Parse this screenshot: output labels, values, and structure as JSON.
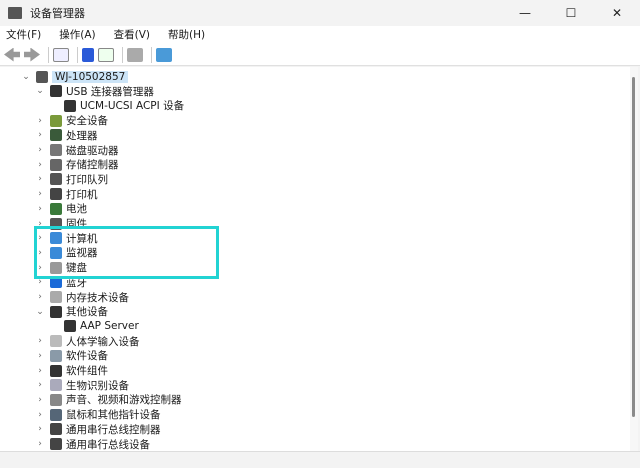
{
  "window": {
    "title": "设备管理器",
    "minimize": "—",
    "maximize": "☐",
    "close": "✕"
  },
  "menu": [
    "文件(F)",
    "操作(A)",
    "查看(V)",
    "帮助(H)"
  ],
  "tree": [
    {
      "label": "WJ-10502857",
      "level": 0,
      "chev": "⌄",
      "color": "#555",
      "selected": true
    },
    {
      "label": "USB 连接器管理器",
      "level": 1,
      "chev": "⌄",
      "color": "#333"
    },
    {
      "label": "UCM-UCSI ACPI 设备",
      "level": 2,
      "chev": "",
      "color": "#333"
    },
    {
      "label": "安全设备",
      "level": 1,
      "chev": "›",
      "color": "#7a9a3a"
    },
    {
      "label": "处理器",
      "level": 1,
      "chev": "›",
      "color": "#3a5a3a"
    },
    {
      "label": "磁盘驱动器",
      "level": 1,
      "chev": "›",
      "color": "#777"
    },
    {
      "label": "存储控制器",
      "level": 1,
      "chev": "›",
      "color": "#666"
    },
    {
      "label": "打印队列",
      "level": 1,
      "chev": "›",
      "color": "#555"
    },
    {
      "label": "打印机",
      "level": 1,
      "chev": "›",
      "color": "#444"
    },
    {
      "label": "电池",
      "level": 1,
      "chev": "›",
      "color": "#3a7a3a"
    },
    {
      "label": "固件",
      "level": 1,
      "chev": "›",
      "color": "#555"
    },
    {
      "label": "计算机",
      "level": 1,
      "chev": "›",
      "color": "#3a8ad8"
    },
    {
      "label": "监视器",
      "level": 1,
      "chev": "›",
      "color": "#3a8ad8"
    },
    {
      "label": "键盘",
      "level": 1,
      "chev": "›",
      "color": "#999"
    },
    {
      "label": "蓝牙",
      "level": 1,
      "chev": "›",
      "color": "#1a6ad8"
    },
    {
      "label": "内存技术设备",
      "level": 1,
      "chev": "›",
      "color": "#aaa"
    },
    {
      "label": "其他设备",
      "level": 1,
      "chev": "⌄",
      "color": "#333"
    },
    {
      "label": "AAP Server",
      "level": 2,
      "chev": "",
      "color": "#333"
    },
    {
      "label": "人体学输入设备",
      "level": 1,
      "chev": "›",
      "color": "#bbb"
    },
    {
      "label": "软件设备",
      "level": 1,
      "chev": "›",
      "color": "#8a9aa8"
    },
    {
      "label": "软件组件",
      "level": 1,
      "chev": "›",
      "color": "#333"
    },
    {
      "label": "生物识别设备",
      "level": 1,
      "chev": "›",
      "color": "#aab"
    },
    {
      "label": "声音、视频和游戏控制器",
      "level": 1,
      "chev": "›",
      "color": "#888"
    },
    {
      "label": "鼠标和其他指针设备",
      "level": 1,
      "chev": "›",
      "color": "#567"
    },
    {
      "label": "通用串行总线控制器",
      "level": 1,
      "chev": "›",
      "color": "#444"
    },
    {
      "label": "通用串行总线设备",
      "level": 1,
      "chev": "›",
      "color": "#444"
    }
  ]
}
